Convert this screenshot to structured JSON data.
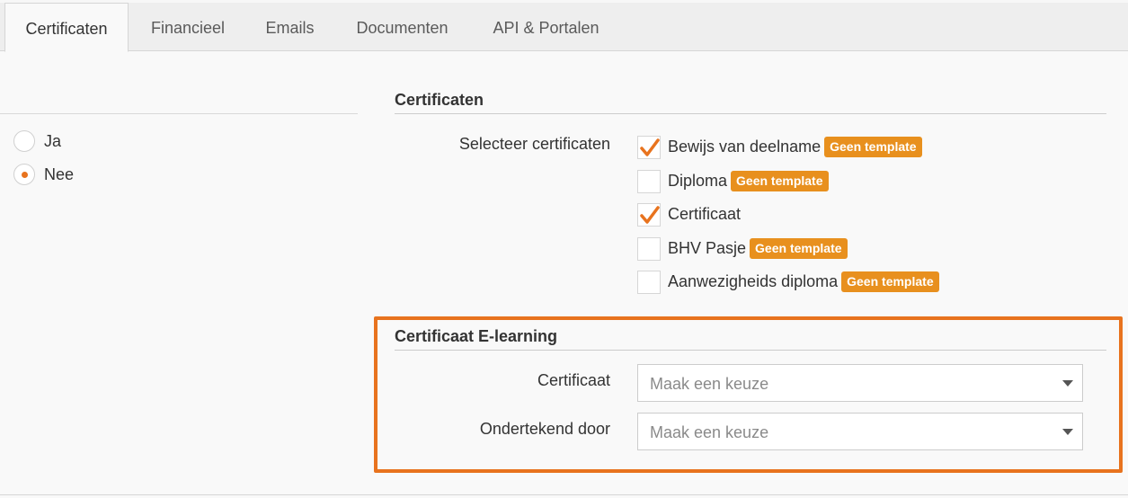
{
  "tabs": [
    {
      "label": "Certificaten",
      "active": true
    },
    {
      "label": "Financieel"
    },
    {
      "label": "Emails"
    },
    {
      "label": "Documenten"
    },
    {
      "label": "API & Portalen"
    }
  ],
  "radio_options": [
    {
      "label": "Ja",
      "checked": false
    },
    {
      "label": "Nee",
      "checked": true
    }
  ],
  "certificates_section": {
    "title": "Certificaten",
    "select_label": "Selecteer certificaten",
    "items": [
      {
        "label": "Bewijs van deelname",
        "checked": true,
        "badge": "Geen template"
      },
      {
        "label": "Diploma",
        "checked": false,
        "badge": "Geen template"
      },
      {
        "label": "Certificaat",
        "checked": true,
        "badge": ""
      },
      {
        "label": "BHV Pasje",
        "checked": false,
        "badge": "Geen template"
      },
      {
        "label": "Aanwezigheids diploma",
        "checked": false,
        "badge": "Geen template"
      }
    ]
  },
  "elearning_section": {
    "title": "Certificaat E-learning",
    "certificate_label": "Certificaat",
    "certificate_value": "Maak een keuze",
    "signed_by_label": "Ondertekend door",
    "signed_by_value": "Maak een keuze"
  },
  "colors": {
    "accent": "#e8731e",
    "badge": "#e8901e"
  }
}
